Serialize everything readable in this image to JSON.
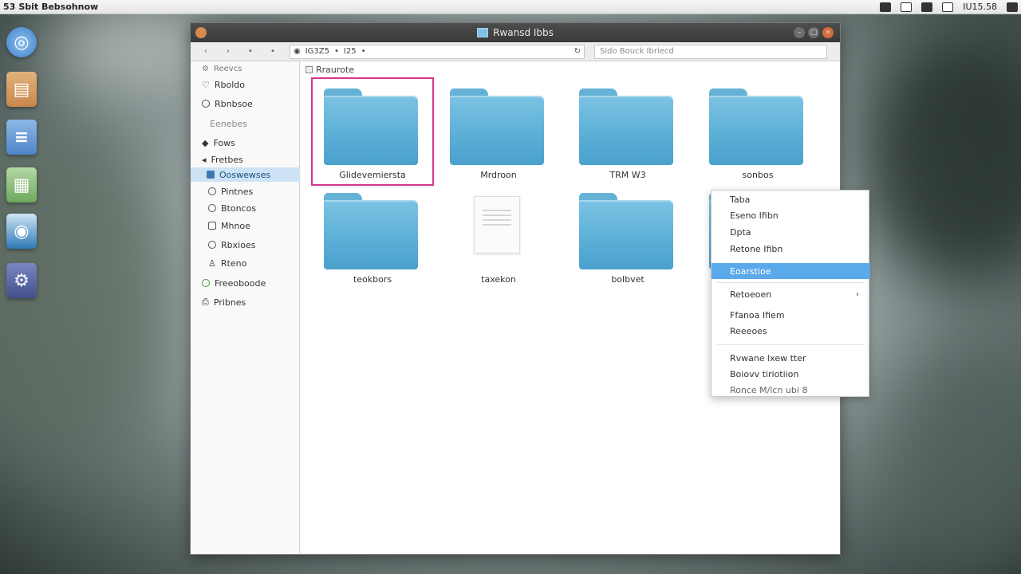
{
  "top_panel": {
    "app_title": "Sbit Bebsohnow",
    "panel_prefix": "53",
    "clock": "IU15.58"
  },
  "launcher": [
    {
      "name": "browser",
      "color": "#3d7fc9"
    },
    {
      "name": "archive",
      "color": "#c9874a"
    },
    {
      "name": "document",
      "color": "#4f85c9"
    },
    {
      "name": "spreadsheet",
      "color": "#6ea85c"
    },
    {
      "name": "disc",
      "color": "#2d78b6"
    },
    {
      "name": "settings",
      "color": "#44508a"
    }
  ],
  "window": {
    "title": "Rwansd Ibbs"
  },
  "toolbar": {
    "buttons": [
      "‹",
      "›",
      "•",
      "•"
    ],
    "location_prefix": "IG3Z5",
    "location_mid": "•",
    "location_num": "I25",
    "location_extra": "•",
    "search_placeholder": "Sldo Bouck Ibriecd"
  },
  "sidebar": {
    "header": "Reevcs",
    "items": [
      {
        "label": "Rboldo"
      },
      {
        "label": "Rbnbsoe"
      },
      {
        "label": "Eenebes"
      },
      {
        "label": "Fows"
      },
      {
        "label": "Fretbes"
      },
      {
        "label": "Ooswewses"
      },
      {
        "label": "Pintnes"
      },
      {
        "label": "Btoncos"
      },
      {
        "label": "Mhnoe"
      },
      {
        "label": "Rbxioes"
      },
      {
        "label": "Rteno"
      },
      {
        "label": "Freeoboode"
      },
      {
        "label": "Pribnes"
      }
    ]
  },
  "content": {
    "breadcrumb": "Rraurote",
    "items": [
      {
        "label": "Glidevemiersta",
        "type": "folder"
      },
      {
        "label": "Mrdroon",
        "type": "folder"
      },
      {
        "label": "TRM W3",
        "type": "folder"
      },
      {
        "label": "sonbos",
        "type": "folder"
      },
      {
        "label": "teokbors",
        "type": "folder"
      },
      {
        "label": "taxekon",
        "type": "file"
      },
      {
        "label": "bolbvet",
        "type": "folder"
      }
    ]
  },
  "context_menu": {
    "items": [
      {
        "label": "Taba"
      },
      {
        "label": "Eseno Ifibn"
      },
      {
        "label": "Dpta"
      },
      {
        "label": "Retone Ifibn"
      },
      {
        "label": "Eoarstioe"
      },
      {
        "label": "Retoeoen"
      },
      {
        "label": "Ffanoa Ifiem"
      },
      {
        "label": "Reeeoes"
      },
      {
        "label": "Rvwane lxew tter"
      },
      {
        "label": "Boiovv tiriotiion"
      },
      {
        "label": "Ronce M/lcn ubi 8"
      }
    ],
    "submenu_arrow": "›",
    "accent": "#5aa9ea"
  },
  "colors": {
    "folder": "#5aaed6",
    "selection_outline": "#d4378f",
    "sidebar_selected": "#cde3f5"
  }
}
